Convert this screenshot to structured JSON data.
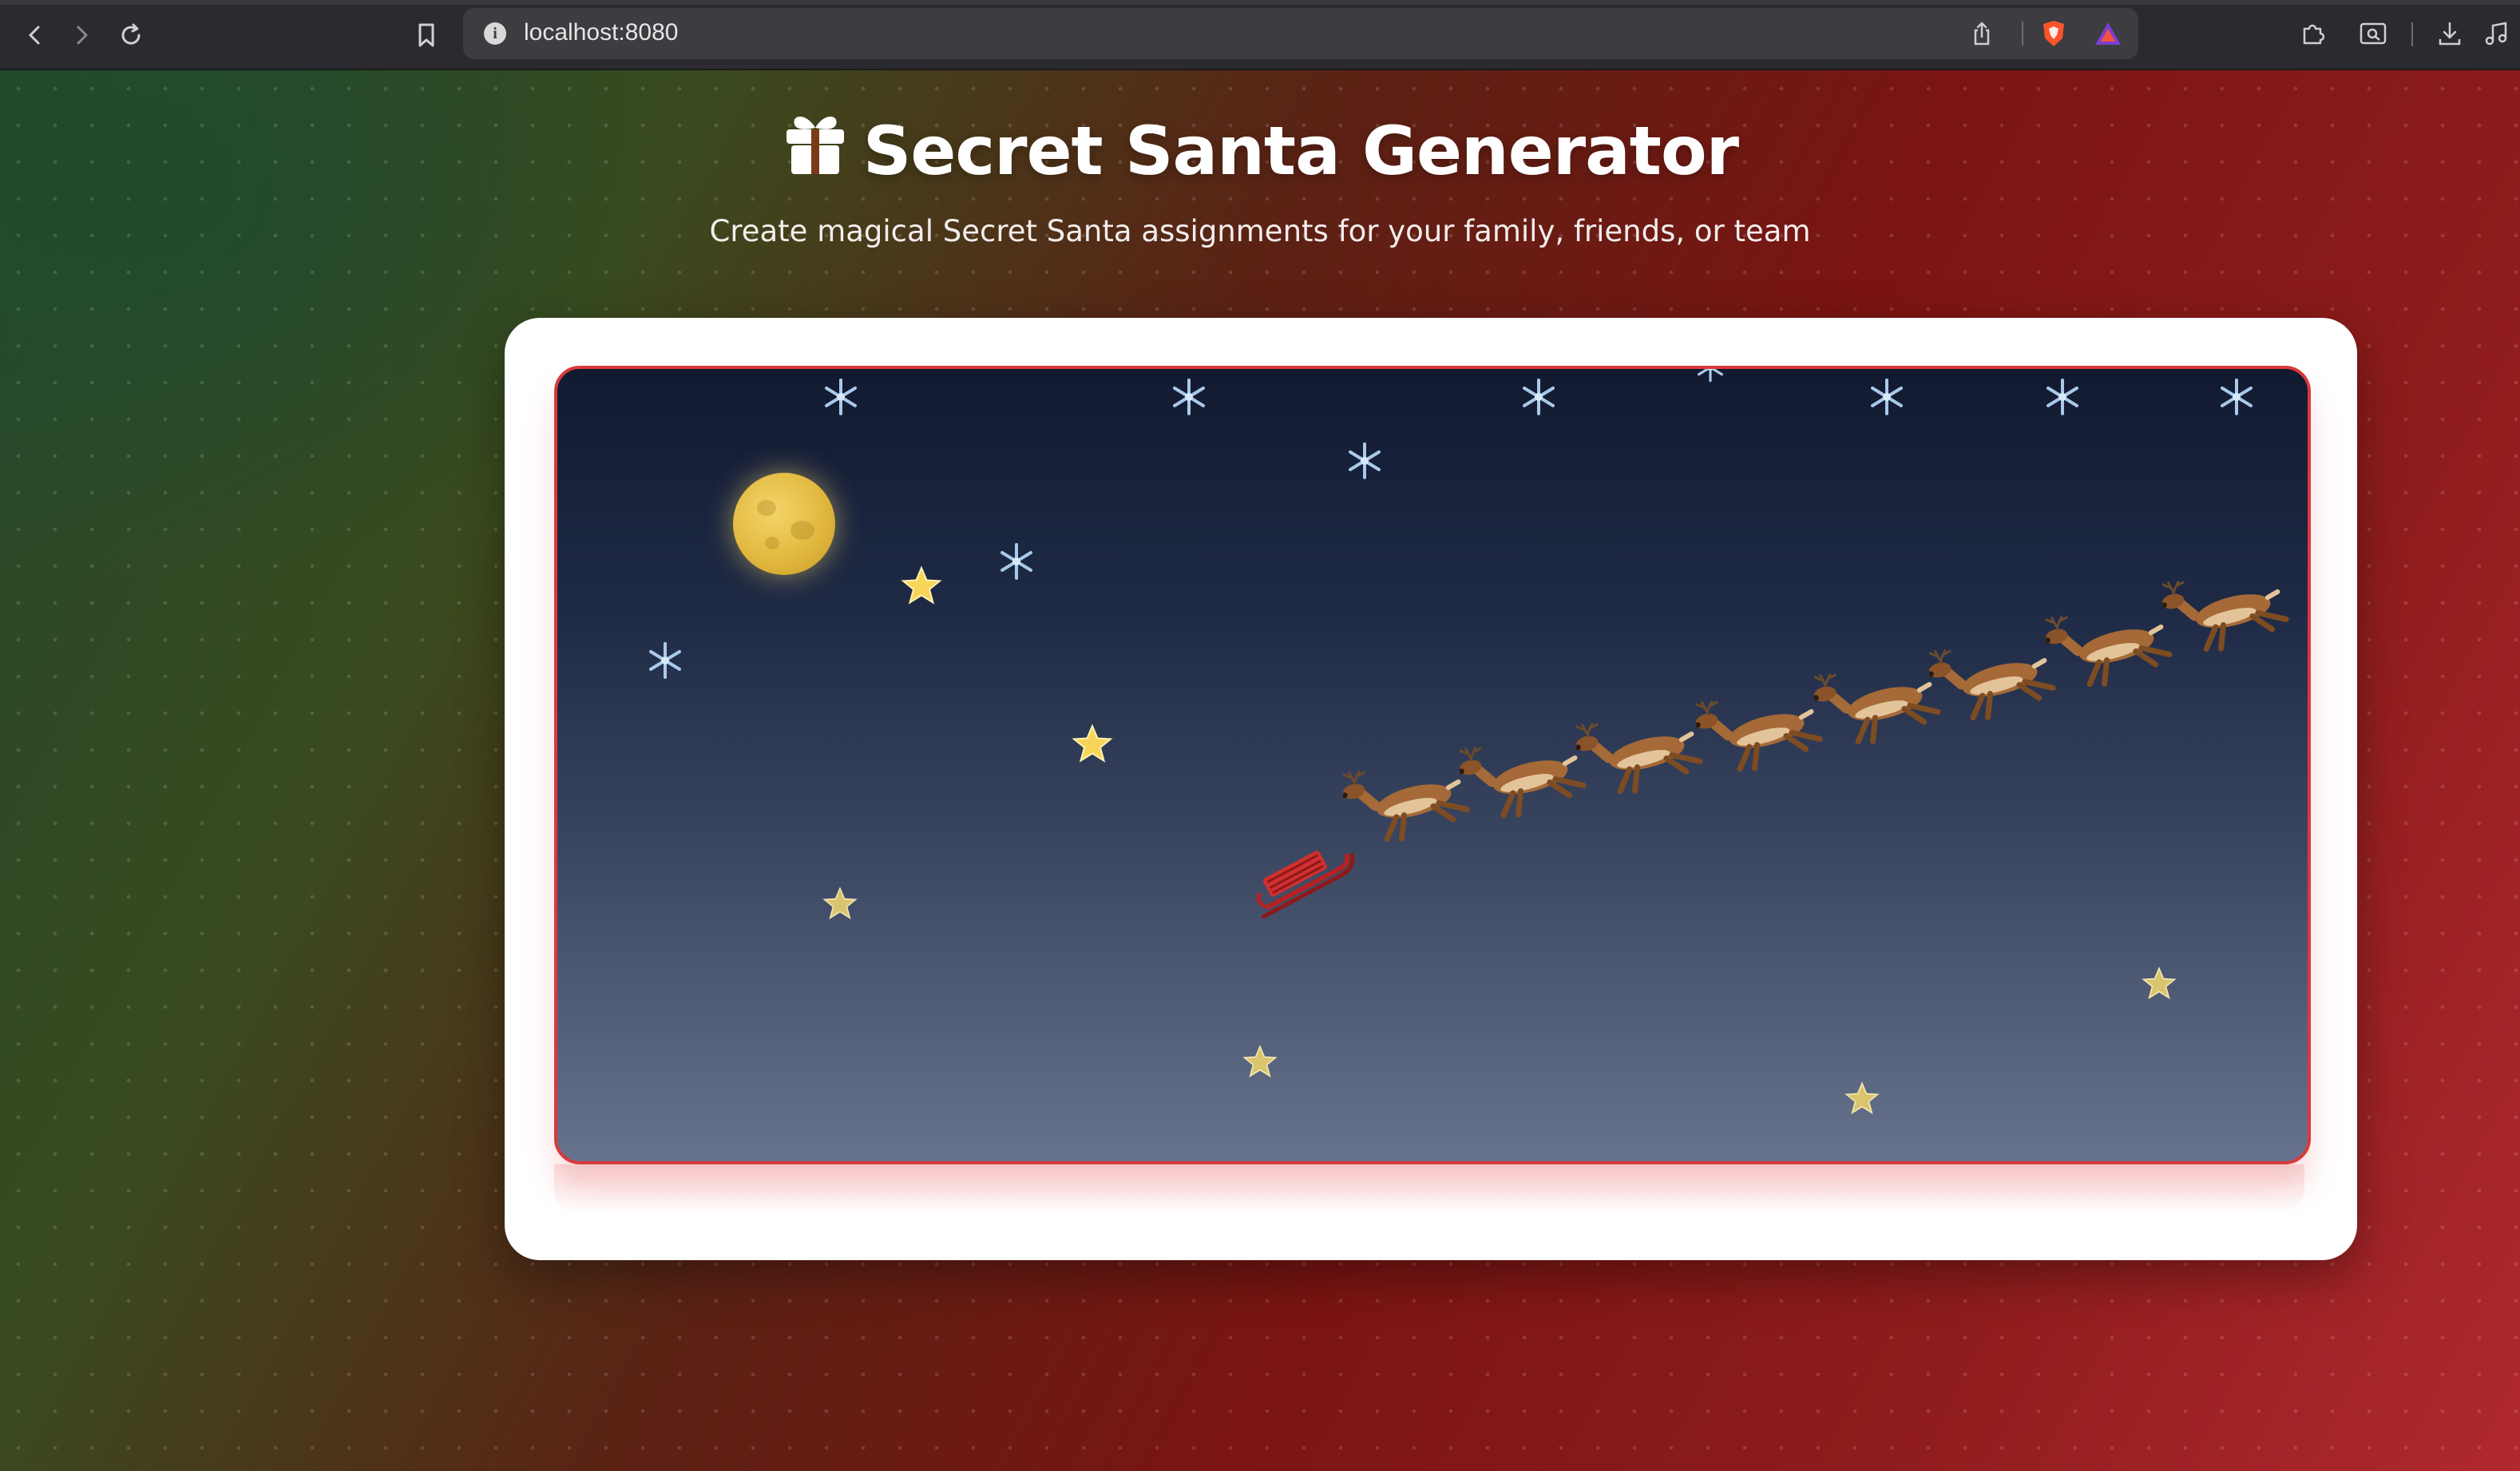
{
  "browser": {
    "url": "localhost:8080",
    "icons": [
      "back-icon",
      "forward-icon",
      "reload-icon",
      "bookmark-icon",
      "info-icon",
      "share-icon",
      "brave-shields-icon",
      "brave-rewards-icon",
      "extensions-icon",
      "reader-icon",
      "download-icon",
      "media-icon"
    ]
  },
  "header": {
    "title": "Secret Santa Generator",
    "title_icon": "gift-icon",
    "subtitle": "Create magical Secret Santa assignments for your family, friends, or team"
  },
  "scene": {
    "icons": [
      "moon",
      "snowflake-icon",
      "star-icon",
      "reindeer-icon",
      "sleigh-icon"
    ]
  },
  "colors": {
    "accent_red": "#d83a3a",
    "bg_green": "#24482c",
    "bg_red": "#8e1c1c",
    "sky_top": "#121a30",
    "sky_bottom": "#67738d",
    "moon": "#e2b93f"
  }
}
